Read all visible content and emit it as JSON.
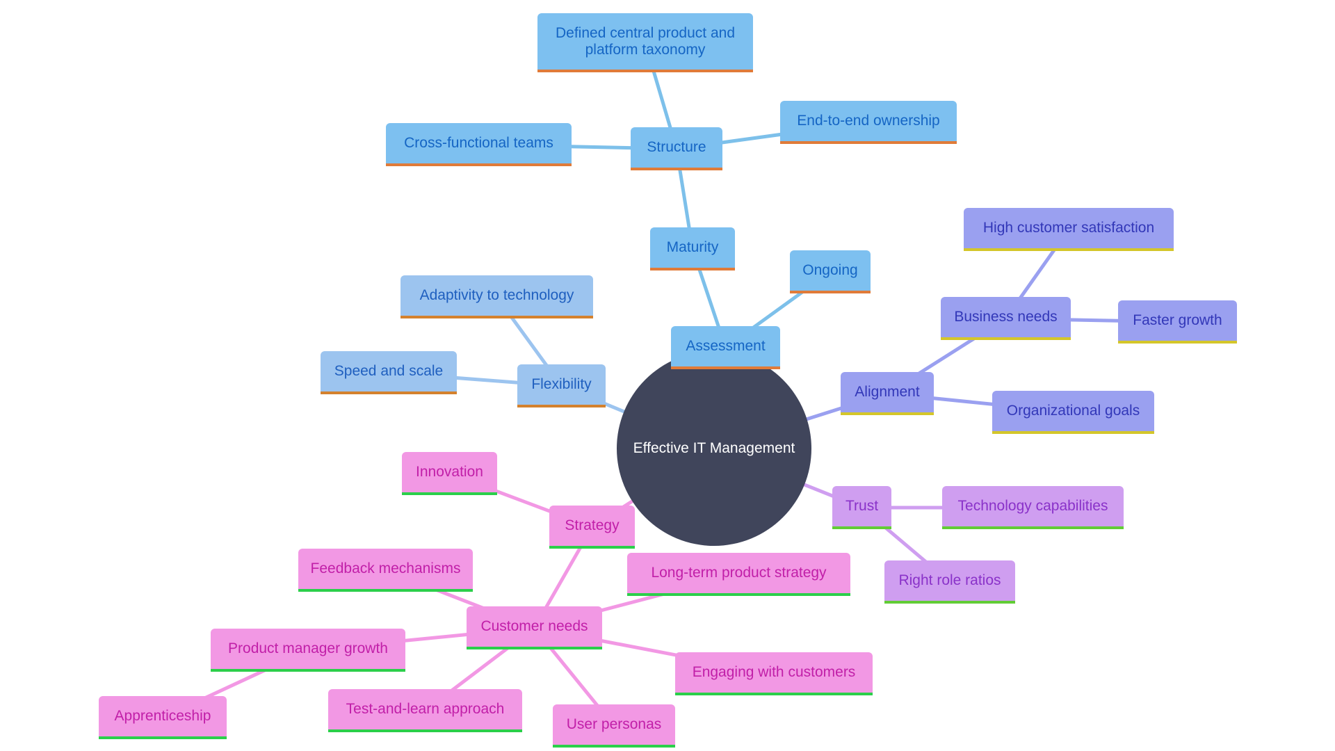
{
  "title": "Effective IT Management",
  "colors": {
    "center": "#40455b",
    "blue_edge": "#7dc0ea",
    "lblue_edge": "#9cc4ef",
    "indigo_edge": "#9aa0f0",
    "purple_edge": "#cf9ef0",
    "pink_edge": "#f298e4"
  },
  "nodes": {
    "center": "Effective IT Management",
    "assessment": "Assessment",
    "maturity": "Maturity",
    "ongoing": "Ongoing",
    "structure": "Structure",
    "defined_taxonomy": "Defined central product and platform taxonomy",
    "cross_functional": "Cross-functional teams",
    "end_to_end": "End-to-end ownership",
    "flexibility": "Flexibility",
    "adaptivity": "Adaptivity to technology",
    "speed_scale": "Speed and scale",
    "alignment": "Alignment",
    "business_needs": "Business needs",
    "high_satisfaction": "High customer satisfaction",
    "faster_growth": "Faster growth",
    "org_goals": "Organizational goals",
    "trust": "Trust",
    "tech_capabilities": "Technology capabilities",
    "right_role_ratios": "Right role ratios",
    "strategy": "Strategy",
    "innovation": "Innovation",
    "customer_needs": "Customer needs",
    "feedback": "Feedback mechanisms",
    "long_term": "Long-term product strategy",
    "pm_growth": "Product manager growth",
    "apprenticeship": "Apprenticeship",
    "engaging": "Engaging with customers",
    "test_learn": "Test-and-learn approach",
    "user_personas": "User personas"
  },
  "edges": [
    [
      "center",
      "assessment",
      "blue_edge"
    ],
    [
      "assessment",
      "maturity",
      "blue_edge"
    ],
    [
      "assessment",
      "ongoing",
      "blue_edge"
    ],
    [
      "maturity",
      "structure",
      "blue_edge"
    ],
    [
      "structure",
      "defined_taxonomy",
      "blue_edge"
    ],
    [
      "structure",
      "cross_functional",
      "blue_edge"
    ],
    [
      "structure",
      "end_to_end",
      "blue_edge"
    ],
    [
      "center",
      "flexibility",
      "lblue_edge"
    ],
    [
      "flexibility",
      "adaptivity",
      "lblue_edge"
    ],
    [
      "flexibility",
      "speed_scale",
      "lblue_edge"
    ],
    [
      "center",
      "alignment",
      "indigo_edge"
    ],
    [
      "alignment",
      "business_needs",
      "indigo_edge"
    ],
    [
      "alignment",
      "org_goals",
      "indigo_edge"
    ],
    [
      "business_needs",
      "high_satisfaction",
      "indigo_edge"
    ],
    [
      "business_needs",
      "faster_growth",
      "indigo_edge"
    ],
    [
      "center",
      "trust",
      "purple_edge"
    ],
    [
      "trust",
      "tech_capabilities",
      "purple_edge"
    ],
    [
      "trust",
      "right_role_ratios",
      "purple_edge"
    ],
    [
      "center",
      "strategy",
      "pink_edge"
    ],
    [
      "strategy",
      "innovation",
      "pink_edge"
    ],
    [
      "strategy",
      "customer_needs",
      "pink_edge"
    ],
    [
      "customer_needs",
      "feedback",
      "pink_edge"
    ],
    [
      "customer_needs",
      "long_term",
      "pink_edge"
    ],
    [
      "customer_needs",
      "pm_growth",
      "pink_edge"
    ],
    [
      "customer_needs",
      "engaging",
      "pink_edge"
    ],
    [
      "customer_needs",
      "test_learn",
      "pink_edge"
    ],
    [
      "customer_needs",
      "user_personas",
      "pink_edge"
    ],
    [
      "pm_growth",
      "apprenticeship",
      "pink_edge"
    ]
  ]
}
